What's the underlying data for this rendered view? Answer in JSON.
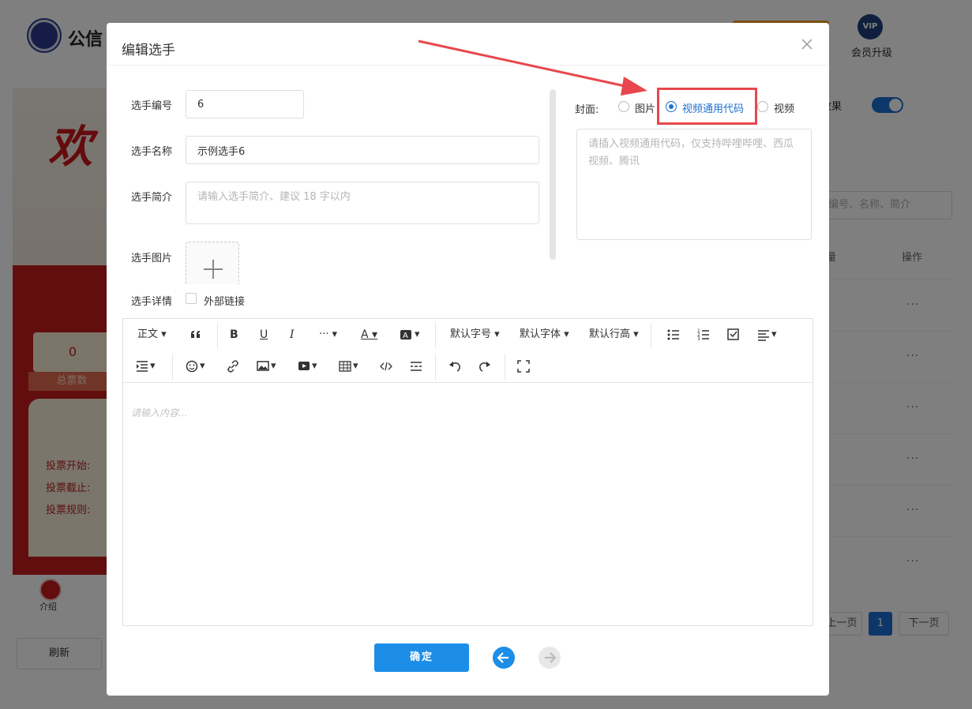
{
  "background": {
    "brand": "公信",
    "vip_badge": "VIP",
    "vip_label": "会员升级",
    "preview": {
      "total_count": "0",
      "total_label": "总票数",
      "vote_start": "投票开始:",
      "vote_end": "投票截止:",
      "vote_rules": "投票规则:",
      "intro_label": "介绍"
    },
    "refresh_label": "刷新",
    "effect_label": "效果",
    "search_placeholder": "编号、名称、简介",
    "col_count": "量",
    "col_op": "操作",
    "row_action": "···",
    "pagination": {
      "prev": "上一页",
      "current": "1",
      "next": "下一页"
    }
  },
  "modal": {
    "title": "编辑选手",
    "fields": {
      "number_label": "选手编号",
      "number_value": "6",
      "name_label": "选手名称",
      "name_value": "示例选手6",
      "intro_label": "选手简介",
      "intro_placeholder": "请输入选手简介、建议 18 字以内",
      "image_label": "选手图片",
      "detail_label": "选手详情",
      "external_link_label": "外部链接"
    },
    "cover": {
      "label": "封面:",
      "options": [
        "图片",
        "视频通用代码",
        "视频"
      ],
      "selected": "视频通用代码",
      "code_placeholder": "请插入视频通用代码，仅支持哔哩哔哩、西瓜视频、腾讯"
    },
    "editor": {
      "toolbar": {
        "paragraph": "正文",
        "font_size": "默认字号",
        "font_family": "默认字体",
        "line_height": "默认行高"
      },
      "placeholder": "请输入内容..."
    },
    "confirm_label": "确定"
  },
  "colors": {
    "primary": "#1c8ee8",
    "highlight": "#e8474d",
    "radio_active": "#1c6fd2"
  }
}
